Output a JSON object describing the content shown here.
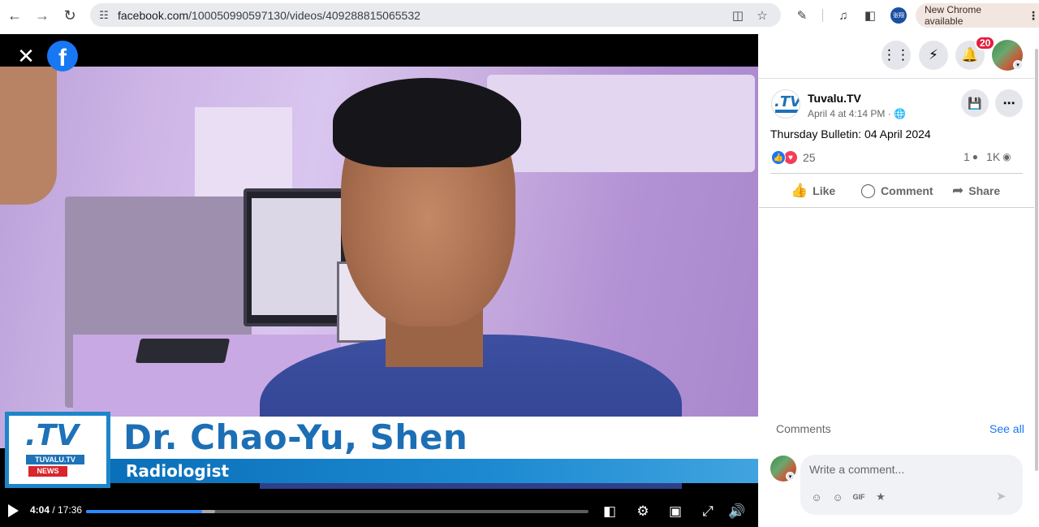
{
  "browser": {
    "url_host": "facebook.com",
    "url_path": "/100050990597130/videos/409288815065532",
    "update_label": "New Chrome available",
    "profile_initials": "张翔"
  },
  "video": {
    "lower_third": {
      "logo_main": ".TV",
      "logo_sub": "TUVALU.TV",
      "logo_news": "NEWS",
      "name": "Dr. Chao-Yu, Shen",
      "role": "Radiologist"
    },
    "current_time": "4:04",
    "separator": " / ",
    "duration": "17:36",
    "progress_fraction": 0.2318,
    "buffered_fraction": 0.257
  },
  "panel": {
    "notification_count": "20",
    "post": {
      "page_name": "Tuvalu.TV",
      "meta": "April 4 at 4:14 PM ·",
      "caption": "Thursday Bulletin: 04 April 2024",
      "reaction_count": "25",
      "comment_count": "1",
      "view_count": "1K"
    },
    "actions": {
      "like": "Like",
      "comment": "Comment",
      "share": "Share"
    },
    "comments_heading": "Comments",
    "see_all": "See all",
    "comment_placeholder": "Write a comment..."
  },
  "colors": {
    "facebook_blue": "#1877f2",
    "notification_red": "#e41e3f",
    "tuvalu_blue": "#1d72b8",
    "love_red": "#f33e58"
  },
  "icons": [
    "back-icon",
    "forward-icon",
    "reload-icon",
    "site-settings-icon",
    "install-app-icon",
    "bookmark-star-icon",
    "extensions-icon",
    "media-control-icon",
    "side-panel-icon",
    "chrome-menu-icon",
    "close-icon",
    "facebook-logo-icon",
    "play-icon",
    "captions-icon",
    "settings-gear-icon",
    "pip-icon",
    "fullscreen-icon",
    "volume-icon",
    "menu-grid-icon",
    "messenger-icon",
    "bell-icon",
    "save-icon",
    "more-options-icon",
    "globe-icon",
    "like-reaction-icon",
    "love-reaction-icon",
    "comment-bubble-icon",
    "eye-icon",
    "like-icon",
    "comment-icon",
    "share-icon",
    "sticker-avatar-icon",
    "emoji-icon",
    "gif-icon",
    "sticker-icon",
    "send-icon"
  ]
}
